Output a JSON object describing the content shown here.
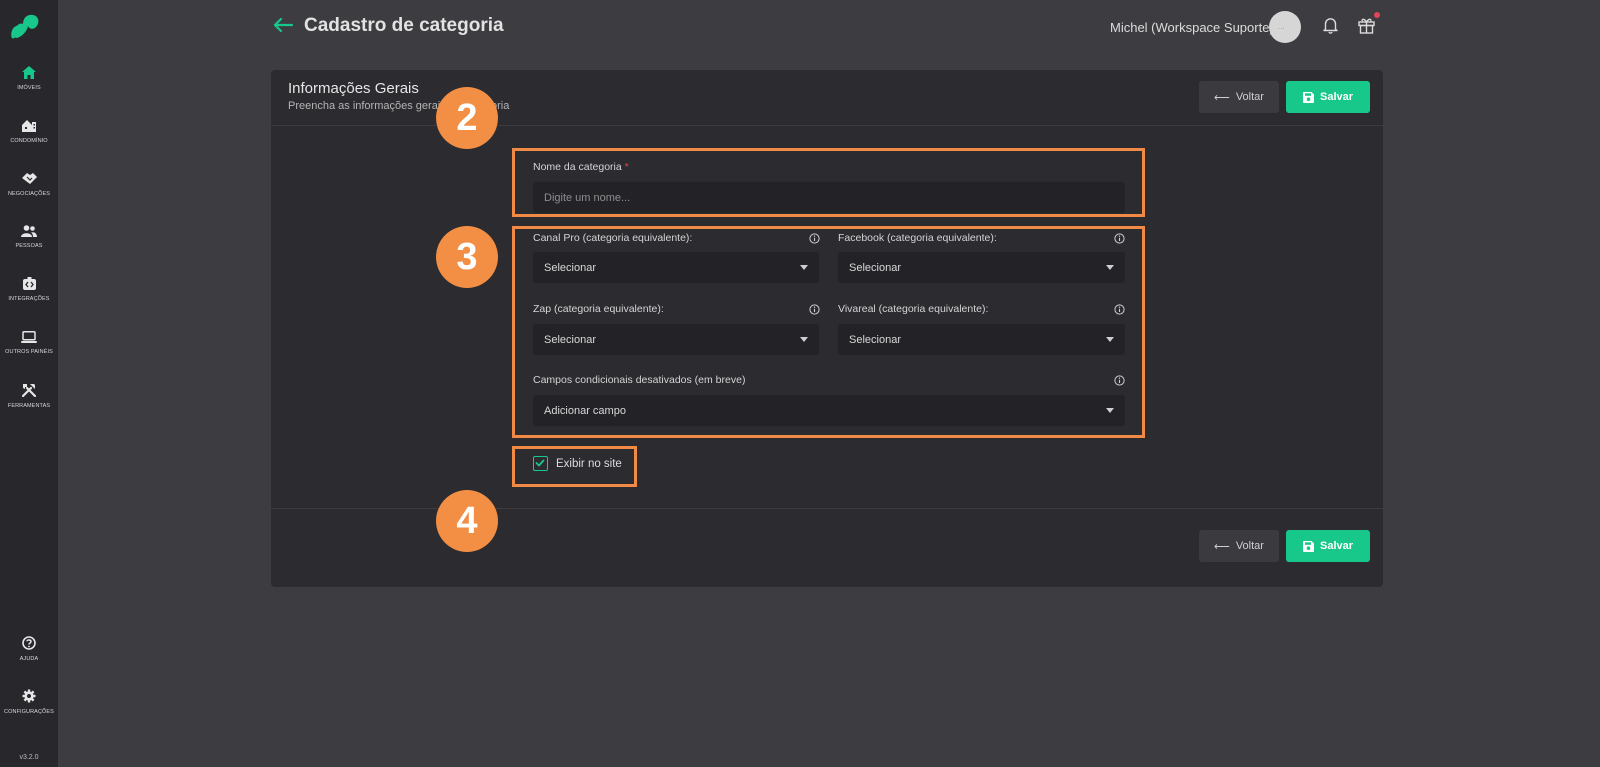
{
  "sidebar": {
    "items": [
      {
        "label": "IMÓVEIS",
        "icon": "home-icon"
      },
      {
        "label": "CONDOMÍNIO",
        "icon": "building-icon"
      },
      {
        "label": "NEGOCIAÇÕES",
        "icon": "handshake-icon"
      },
      {
        "label": "PESSOAS",
        "icon": "people-icon"
      },
      {
        "label": "INTEGRAÇÕES",
        "icon": "integrations-icon"
      },
      {
        "label": "OUTROS PAINÉIS",
        "icon": "laptop-icon"
      },
      {
        "label": "FERRAMENTAS",
        "icon": "tools-icon"
      }
    ],
    "bottom": [
      {
        "label": "AJUDA",
        "icon": "help-icon"
      },
      {
        "label": "CONFIGURAÇÕES",
        "icon": "gear-icon"
      }
    ],
    "version": "v3.2.0"
  },
  "header": {
    "title": "Cadastro de categoria",
    "user": "Michel (Workspace Suporte)",
    "avatar_text": "..."
  },
  "card": {
    "title": "Informações Gerais",
    "subtitle": "Preencha as informações gerais da categoria"
  },
  "buttons": {
    "back": "Voltar",
    "save": "Salvar"
  },
  "annotations": [
    "2",
    "3",
    "4"
  ],
  "form": {
    "name_label": "Nome da categoria",
    "name_required": "*",
    "name_placeholder": "Digite um nome...",
    "canalpro_label": "Canal Pro (categoria equivalente):",
    "canalpro_value": "Selecionar",
    "facebook_label": "Facebook (categoria equivalente):",
    "facebook_value": "Selecionar",
    "zap_label": "Zap (categoria equivalente):",
    "zap_value": "Selecionar",
    "vivareal_label": "Vivareal (categoria equivalente):",
    "vivareal_value": "Selecionar",
    "conditional_label": "Campos condicionais desativados (em breve)",
    "conditional_value": "Adicionar campo",
    "show_on_site_label": "Exibir no site",
    "show_on_site_checked": true
  },
  "colors": {
    "accent": "#17c88a",
    "highlight": "#f08a45",
    "badge": "#f28f45",
    "notification": "#e0455c"
  }
}
